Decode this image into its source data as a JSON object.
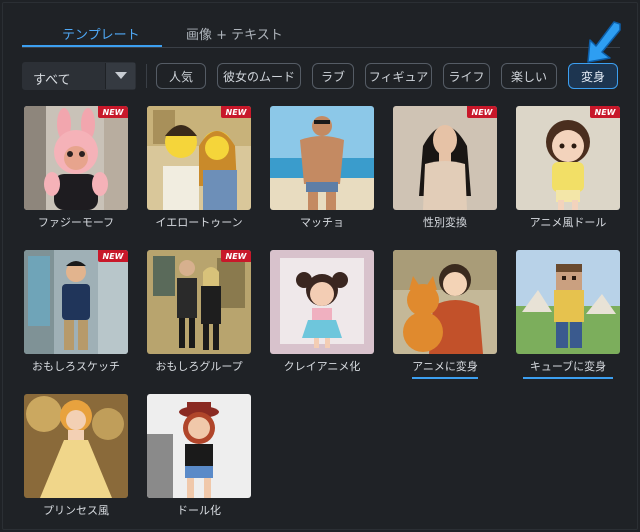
{
  "tabs": {
    "templates": "テンプレート",
    "image_text": "画像 + テキスト"
  },
  "filter": {
    "dropdown_value": "すべて",
    "chips": [
      "人気",
      "彼女のムード",
      "ラブ",
      "フィギュア",
      "ライフ",
      "楽しい",
      "変身"
    ]
  },
  "badge": "NEW",
  "cards": [
    {
      "label": "ファジーモーフ",
      "is_new": true
    },
    {
      "label": "イエロートゥーン",
      "is_new": true
    },
    {
      "label": "マッチョ",
      "is_new": false
    },
    {
      "label": "性別変換",
      "is_new": true
    },
    {
      "label": "アニメ風ドール",
      "is_new": true
    },
    {
      "label": "おもしろスケッチ",
      "is_new": true
    },
    {
      "label": "おもしろグループ",
      "is_new": true
    },
    {
      "label": "クレイアニメ化",
      "is_new": false
    },
    {
      "label": "アニメに変身",
      "is_new": false
    },
    {
      "label": "キューブに変身",
      "is_new": false
    },
    {
      "label": "プリンセス風",
      "is_new": false
    },
    {
      "label": "ドール化",
      "is_new": false
    }
  ],
  "colors": {
    "accent": "#3c9ff0",
    "badge": "#c8182a",
    "background": "#1f2226"
  }
}
